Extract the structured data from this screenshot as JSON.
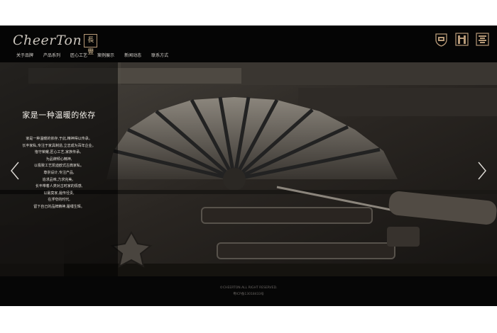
{
  "brand": {
    "logo_text": "CheerTon",
    "logo_mark": "長豐"
  },
  "nav": {
    "items": [
      {
        "label": "关于品牌"
      },
      {
        "label": "产品系列"
      },
      {
        "label": "匠心工艺"
      },
      {
        "label": "案例展示"
      },
      {
        "label": "新闻动态"
      },
      {
        "label": "联系方式"
      }
    ]
  },
  "badges": [
    {
      "icon": "shield-badge-icon"
    },
    {
      "icon": "tower-badge-icon"
    },
    {
      "icon": "column-badge-icon"
    }
  ],
  "hero": {
    "title": "家是一种温暖的依存",
    "lines": [
      "家是一种温暖的依存,于此,精神得以传承。",
      "长丰家私,专注于家具制造,立志成为百年企业。",
      "恪守荣耀,匠心工艺,家族传承。",
      "为品牌倾心精神,",
      "以极致工艺凯迪欧式古典家私。",
      "尊崇设计,专注产品,",
      "追求品味,力求完美。",
      "长丰带着人类对古时家的情感,",
      "以最莫家,履传径责,",
      "在浮夸的时代,",
      "留下自己的品牌精神,履缰生辉。"
    ],
    "prev_icon": "chevron-left-icon",
    "next_icon": "chevron-right-icon"
  },
  "footer": {
    "copyright": "©CHEERTON.ALL RIGHT RESERVED.",
    "icp": "粤ICP备13018433号"
  },
  "colors": {
    "header_bg": "#050505",
    "accent_gold": "#b79a78",
    "nav_text": "#d8d4cf",
    "footer_text": "#6a6663"
  }
}
